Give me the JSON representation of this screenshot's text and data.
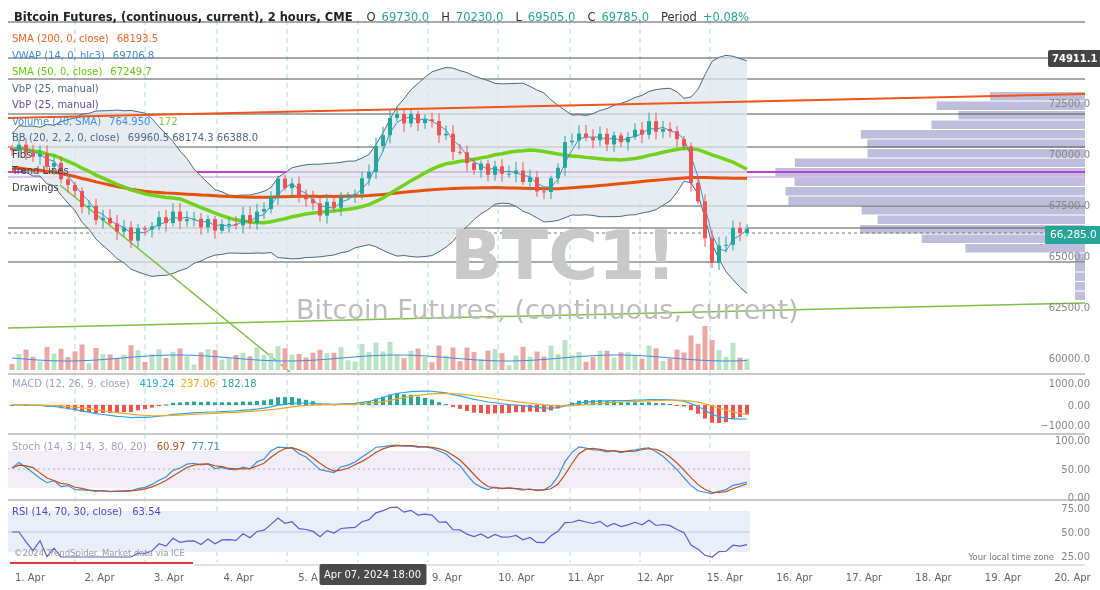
{
  "header": {
    "title": "Bitcoin Futures, (continuous, current), 2 hours, CME",
    "ohlc": [
      {
        "label": "O",
        "value": "69730.0"
      },
      {
        "label": "H",
        "value": "70230.0"
      },
      {
        "label": "L",
        "value": "69505.0"
      },
      {
        "label": "C",
        "value": "69785.0"
      }
    ],
    "period_label": "Period",
    "period_value": "+0.08%"
  },
  "indicators": [
    {
      "name": "SMA (200, 0, close)",
      "color": "#f26522",
      "values": [
        {
          "text": "68193.5",
          "color": "#f26522"
        }
      ]
    },
    {
      "name": "VWAP (14, 0, hlc3)",
      "color": "#3f8ee0",
      "values": [
        {
          "text": "69706.8",
          "color": "#3f8ee0"
        }
      ]
    },
    {
      "name": "SMA (50, 0, close)",
      "color": "#5fcf0f",
      "values": [
        {
          "text": "67249.7",
          "color": "#5fcf0f"
        }
      ]
    },
    {
      "name": "VbP (25, manual)",
      "color": "#4f6a8c"
    },
    {
      "name": "VbP (25, manual)",
      "color": "#6a4fa0"
    },
    {
      "name": "Volume (20, SMA)",
      "color": "#3f8ee0",
      "values": [
        {
          "text": "764.950",
          "color": "#3f8ee0"
        },
        {
          "text": "172",
          "color": "#8bc34a"
        }
      ]
    },
    {
      "name": "BB (20, 2, 2, 0, close)",
      "color": "#4a6a85",
      "values": [
        {
          "text": "69960.5 68174.3 66388.0",
          "color": "#4a6a85"
        }
      ]
    },
    {
      "name": "Fibs",
      "color": "#444444"
    },
    {
      "name": "Trend Lines",
      "color": "#444444"
    },
    {
      "name": "Drawings",
      "color": "#444444"
    }
  ],
  "watermark": {
    "symbol": "BTC1!",
    "description": "Bitcoin Futures, (continuous, current)"
  },
  "price_axis": {
    "ticks": [
      "72500.0",
      "70000.0",
      "67500.0",
      "65000.0",
      "62500.0",
      "60000.0"
    ],
    "high_marker": "74911.1",
    "last_price": "66,285.0"
  },
  "macd": {
    "label": "MACD (12, 26, 9, close)",
    "values": [
      {
        "text": "419.24",
        "color": "#29a8e0"
      },
      {
        "text": "237.06",
        "color": "#f5a623"
      },
      {
        "text": "182.18",
        "color": "#26a69a"
      }
    ],
    "ticks": [
      "1000.00",
      "0.00",
      "−1000.00"
    ]
  },
  "stoch": {
    "label": "Stoch (14, 3, 14, 3, 80, 20)",
    "values": [
      {
        "text": "60.97",
        "color": "#c0501f"
      },
      {
        "text": "77.71",
        "color": "#3f8ee0"
      }
    ],
    "ticks": [
      "100.00",
      "50.00",
      "0.00"
    ]
  },
  "rsi": {
    "label": "RSI (14, 70, 30, close)",
    "values": [
      {
        "text": "63.54",
        "color": "#4a4ad0"
      }
    ],
    "ticks": [
      "75.00",
      "50.00",
      "25.00"
    ]
  },
  "copyright": "©2024 TrendSpider. Market data via ICE",
  "timezone": "Your local time zone",
  "time_axis": [
    {
      "kind": "tick",
      "label": "1. Apr"
    },
    {
      "kind": "tick",
      "label": "2. Apr"
    },
    {
      "kind": "tick",
      "label": "3. Apr"
    },
    {
      "kind": "tick",
      "label": "4. Apr"
    },
    {
      "kind": "tick",
      "label": "5. A"
    },
    {
      "kind": "cursor",
      "label": "Apr 07, 2024 18:00"
    },
    {
      "kind": "tick",
      "label": "9. Apr"
    },
    {
      "kind": "tick",
      "label": "10. Apr"
    },
    {
      "kind": "tick",
      "label": "11. Apr"
    },
    {
      "kind": "tick",
      "label": "12. Apr"
    },
    {
      "kind": "tick",
      "label": "15. Apr"
    },
    {
      "kind": "tick",
      "label": "16. Apr"
    },
    {
      "kind": "tick",
      "label": "17. Apr"
    },
    {
      "kind": "tick",
      "label": "18. Apr"
    },
    {
      "kind": "tick",
      "label": "19. Apr"
    },
    {
      "kind": "tick",
      "label": "20. Apr"
    }
  ]
}
